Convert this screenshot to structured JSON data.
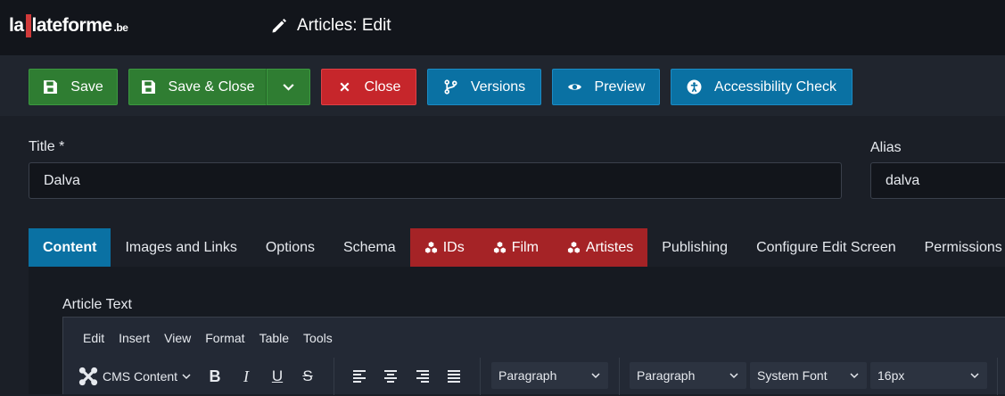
{
  "header": {
    "logo": {
      "part1": "la",
      "part2": "lateforme",
      "tld": ".be"
    },
    "page_title": "Articles: Edit"
  },
  "toolbar": {
    "save": "Save",
    "save_close": "Save & Close",
    "close": "Close",
    "versions": "Versions",
    "preview": "Preview",
    "accessibility_check": "Accessibility Check"
  },
  "form": {
    "title_label": "Title *",
    "title_value": "Dalva",
    "alias_label": "Alias",
    "alias_value": "dalva"
  },
  "tabs": [
    {
      "label": "Content"
    },
    {
      "label": "Images and Links"
    },
    {
      "label": "Options"
    },
    {
      "label": "Schema"
    },
    {
      "label": "IDs"
    },
    {
      "label": "Film"
    },
    {
      "label": "Artistes"
    },
    {
      "label": "Publishing"
    },
    {
      "label": "Configure Edit Screen"
    },
    {
      "label": "Permissions"
    }
  ],
  "editor": {
    "article_text_label": "Article Text",
    "menu": [
      "Edit",
      "Insert",
      "View",
      "Format",
      "Table",
      "Tools"
    ],
    "cms_content": "CMS Content",
    "block_format_1": "Paragraph",
    "block_format_2": "Paragraph",
    "font_family": "System Font",
    "font_size": "16px"
  },
  "colors": {
    "green": "#2f7d32",
    "red": "#c6262b",
    "blue": "#0a71a3",
    "tab_red": "#a52326"
  }
}
